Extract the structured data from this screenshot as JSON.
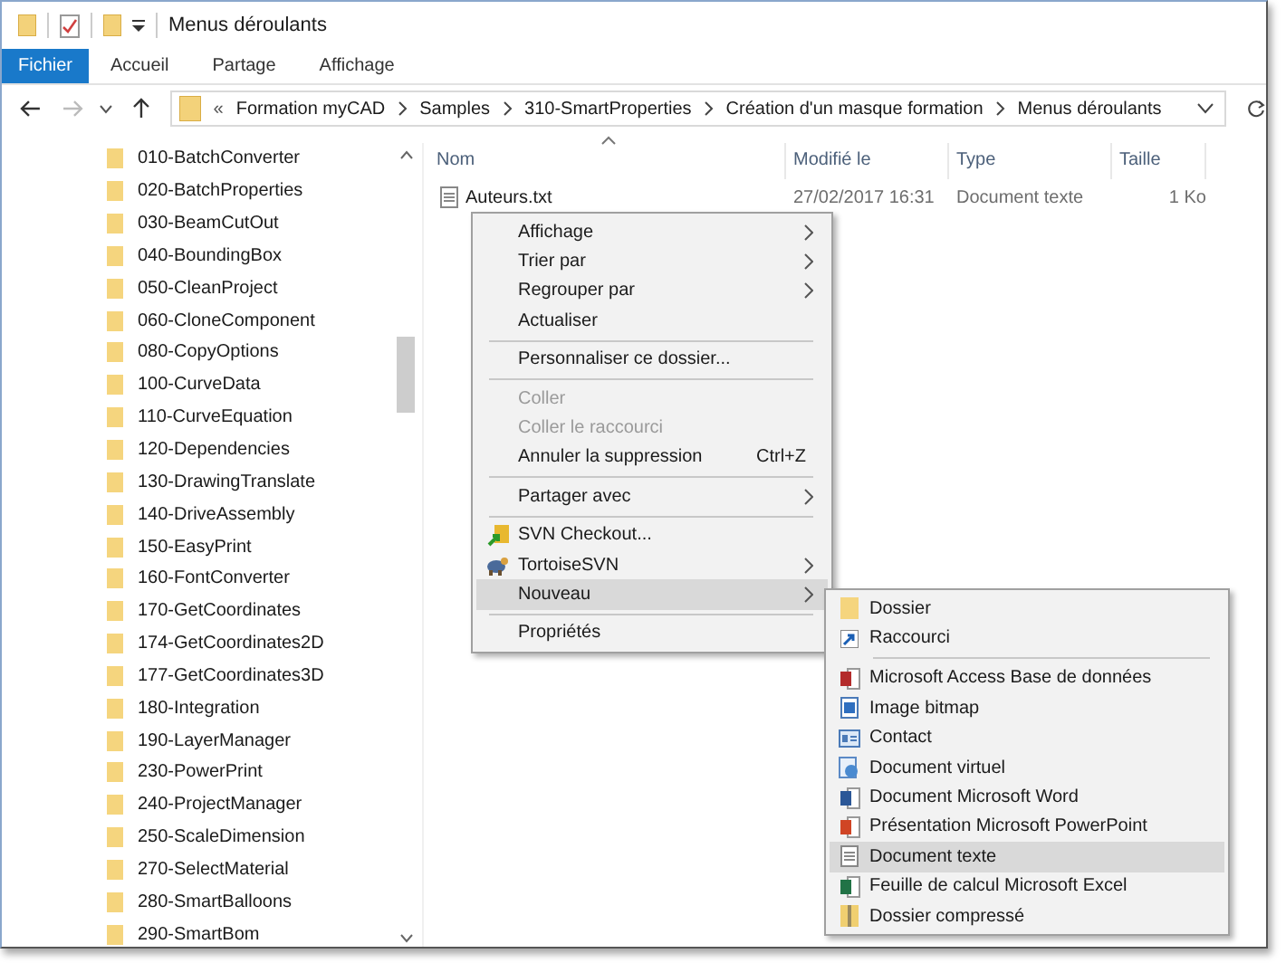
{
  "window": {
    "title": "Menus déroulants"
  },
  "ribbon_tabs": [
    {
      "label": "Fichier",
      "selected": true
    },
    {
      "label": "Accueil",
      "selected": false
    },
    {
      "label": "Partage",
      "selected": false
    },
    {
      "label": "Affichage",
      "selected": false
    }
  ],
  "address_bar": {
    "overflow": "«",
    "segments": [
      "Formation myCAD",
      "Samples",
      "310-SmartProperties",
      "Création d'un masque formation",
      "Menus déroulants"
    ]
  },
  "navigation_pane": {
    "items": [
      "010-BatchConverter",
      "020-BatchProperties",
      "030-BeamCutOut",
      "040-BoundingBox",
      "050-CleanProject",
      "060-CloneComponent",
      "080-CopyOptions",
      "100-CurveData",
      "110-CurveEquation",
      "120-Dependencies",
      "130-DrawingTranslate",
      "140-DriveAssembly",
      "150-EasyPrint",
      "160-FontConverter",
      "170-GetCoordinates",
      "174-GetCoordinates2D",
      "177-GetCoordinates3D",
      "180-Integration",
      "190-LayerManager",
      "230-PowerPrint",
      "240-ProjectManager",
      "250-ScaleDimension",
      "270-SelectMaterial",
      "280-SmartBalloons",
      "290-SmartBom"
    ]
  },
  "file_list": {
    "columns": [
      "Nom",
      "Modifié le",
      "Type",
      "Taille"
    ],
    "rows": [
      {
        "name": "Auteurs.txt",
        "modified": "27/02/2017 16:31",
        "type": "Document texte",
        "size": "1 Ko"
      }
    ]
  },
  "context_menu": {
    "items": [
      {
        "kind": "item",
        "label": "Affichage",
        "submenu": true,
        "disabled": false,
        "selected": false
      },
      {
        "kind": "item",
        "label": "Trier par",
        "submenu": true,
        "disabled": false,
        "selected": false
      },
      {
        "kind": "item",
        "label": "Regrouper par",
        "submenu": true,
        "disabled": false,
        "selected": false
      },
      {
        "kind": "item",
        "label": "Actualiser",
        "submenu": false,
        "disabled": false,
        "selected": false
      },
      {
        "kind": "separator"
      },
      {
        "kind": "item",
        "label": "Personnaliser ce dossier...",
        "submenu": false,
        "disabled": false,
        "selected": false
      },
      {
        "kind": "separator"
      },
      {
        "kind": "item",
        "label": "Coller",
        "submenu": false,
        "disabled": true,
        "selected": false
      },
      {
        "kind": "item",
        "label": "Coller le raccourci",
        "submenu": false,
        "disabled": true,
        "selected": false
      },
      {
        "kind": "item",
        "label": "Annuler la suppression",
        "shortcut": "Ctrl+Z",
        "submenu": false,
        "disabled": false,
        "selected": false
      },
      {
        "kind": "separator"
      },
      {
        "kind": "item",
        "label": "Partager avec",
        "submenu": true,
        "disabled": false,
        "selected": false
      },
      {
        "kind": "separator"
      },
      {
        "kind": "item",
        "label": "SVN Checkout...",
        "submenu": false,
        "disabled": false,
        "selected": false
      },
      {
        "kind": "item",
        "label": "TortoiseSVN",
        "submenu": true,
        "disabled": false,
        "selected": false
      },
      {
        "kind": "item",
        "label": "Nouveau",
        "submenu": true,
        "disabled": false,
        "selected": true
      },
      {
        "kind": "separator"
      },
      {
        "kind": "item",
        "label": "Propriétés",
        "submenu": false,
        "disabled": false,
        "selected": false
      }
    ]
  },
  "new_submenu": {
    "items": [
      {
        "kind": "item",
        "label": "Dossier",
        "selected": false
      },
      {
        "kind": "item",
        "label": "Raccourci",
        "selected": false
      },
      {
        "kind": "separator"
      },
      {
        "kind": "item",
        "label": "Microsoft Access Base de données",
        "selected": false
      },
      {
        "kind": "item",
        "label": "Image bitmap",
        "selected": false
      },
      {
        "kind": "item",
        "label": "Contact",
        "selected": false
      },
      {
        "kind": "item",
        "label": "Document virtuel",
        "selected": false
      },
      {
        "kind": "item",
        "label": "Document Microsoft Word",
        "selected": false
      },
      {
        "kind": "item",
        "label": "Présentation Microsoft PowerPoint",
        "selected": false
      },
      {
        "kind": "item",
        "label": "Document texte",
        "selected": true
      },
      {
        "kind": "item",
        "label": "Feuille de calcul Microsoft Excel",
        "selected": false
      },
      {
        "kind": "item",
        "label": "Dossier compressé",
        "selected": false
      }
    ]
  }
}
